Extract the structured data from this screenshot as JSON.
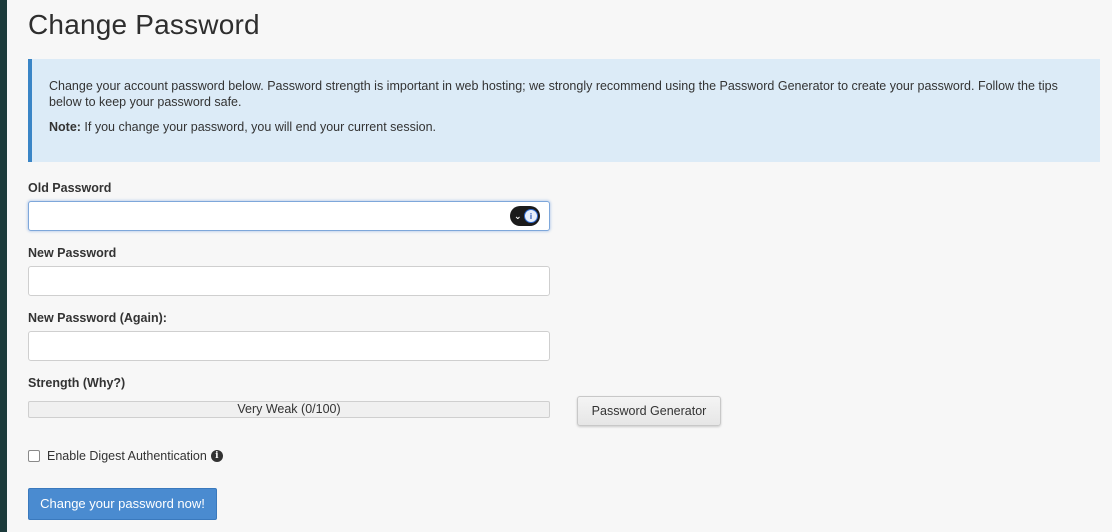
{
  "page": {
    "title": "Change Password"
  },
  "info": {
    "text": "Change your account password below. Password strength is important in web hosting; we strongly recommend using the Password Generator to create your password. Follow the tips below to keep your password safe.",
    "note_label": "Note:",
    "note_text": " If you change your password, you will end your current session."
  },
  "form": {
    "old_password_label": "Old Password",
    "old_password_value": "",
    "new_password_label": "New Password",
    "new_password_value": "",
    "new_password_again_label": "New Password (Again):",
    "new_password_again_value": "",
    "strength_label": "Strength (Why?)",
    "strength_text": "Very Weak (0/100)",
    "strength_value": 0,
    "generator_button": "Password Generator",
    "digest_label": "Enable Digest Authentication",
    "digest_checked": false,
    "submit_button": "Change your password now!"
  },
  "icons": {
    "password_manager": "password-manager-icon",
    "info": "info-icon"
  },
  "colors": {
    "accent": "#4a8bd0",
    "info_bg": "#dcebf7",
    "info_border": "#3a85c6",
    "sidebar": "#1c3b3c"
  }
}
